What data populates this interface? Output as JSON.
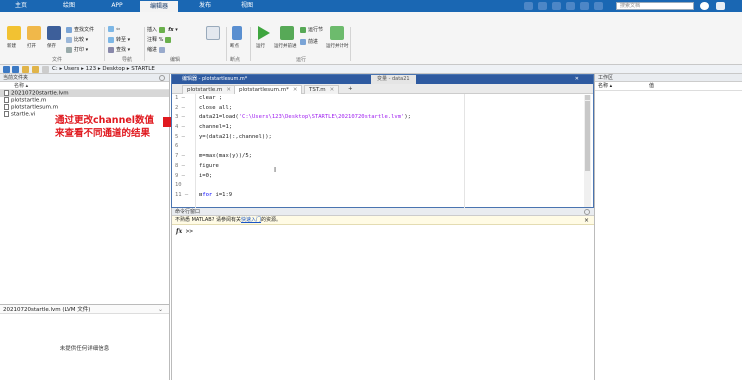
{
  "tabs": [
    "主页",
    "绘图",
    "APP",
    "编辑器",
    "发布",
    "视图"
  ],
  "search": {
    "placeholder": "搜索文档"
  },
  "ribbon": {
    "new_label": "新建",
    "open_label": "打开",
    "save_label": "保存",
    "find_files": "查找文件",
    "compare": "比较",
    "print": "打印",
    "goto": "转至",
    "find": "查找",
    "insert": "插入",
    "comment": "注释",
    "indent": "缩进",
    "breakpoint_label": "断点",
    "run_label": "运行",
    "run_advance_label": "运行并前进",
    "run_section": "运行节",
    "advance": "前进",
    "run_time_label": "运行并计时",
    "sections": {
      "file": "文件",
      "navigate": "导航",
      "edit": "编辑",
      "breakpoints": "断点",
      "run": "运行"
    }
  },
  "address": {
    "path": "C: ▸ Users ▸ 123 ▸ Desktop ▸ STARTLE"
  },
  "folder_panel": {
    "title": "当前文件夹",
    "column_name": "名称 ▴",
    "files": [
      "20210720startle.lvm",
      "plotstartle.m",
      "plotstartlesum.m",
      "startle.vi"
    ],
    "details_title": "20210720startle.lvm (LVM 文件)",
    "details_message": "未提供任何详细信息"
  },
  "annotation": {
    "line1": "通过更改channel数值",
    "line2": "来查看不同通道的结果"
  },
  "editor": {
    "title": "编辑器 - plotstartlesum.m*",
    "variable_tab": "变量 - data21",
    "tabs": [
      "plotstartle.m",
      "plotstartlesum.m*",
      "TST.m"
    ],
    "add_tab": "+",
    "lines": [
      {
        "num": "1 —",
        "text": "clear ;"
      },
      {
        "num": "2 —",
        "text": "close all;"
      },
      {
        "num": "3 —",
        "pre": "data21=load(",
        "str": "'C:\\Users\\123\\Desktop\\STARTLE\\20210720startle.lvm'",
        "post": ");"
      },
      {
        "num": "4 —",
        "text": "channel=1;"
      },
      {
        "num": "5 —",
        "text": "y=(data21(:,channel));"
      },
      {
        "num": "6",
        "text": ""
      },
      {
        "num": "7 —",
        "text": "m=max(max(y))/5;"
      },
      {
        "num": "8 —",
        "text": "figure"
      },
      {
        "num": "9 —",
        "text": "i=0;"
      },
      {
        "num": "10",
        "text": ""
      },
      {
        "num": "11 —",
        "kw": "for",
        "post": " i=1:9"
      }
    ]
  },
  "command_window": {
    "title": "命令行窗口",
    "info_pre": "不熟悉 MATLAB? 请参阅有关",
    "info_link": "快速入门",
    "info_post": "的资源。",
    "prompt": ">>"
  },
  "workspace": {
    "title": "工作区",
    "col_name": "名称 ▴",
    "col_value": "值"
  },
  "colors": {
    "accent": "#1a67b3",
    "annotation": "#e0191f",
    "string": "#a020f0"
  }
}
